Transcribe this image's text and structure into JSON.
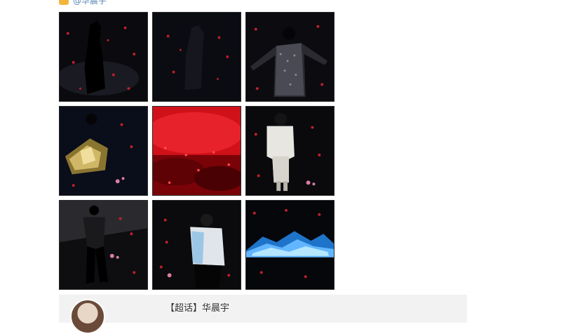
{
  "post": {
    "mention": "@华晨宇"
  },
  "grid": {
    "photos": [
      {
        "icon": "singer-silhouette-petals"
      },
      {
        "icon": "dark-stage-petals"
      },
      {
        "icon": "arms-spread-sequined-coat"
      },
      {
        "icon": "gold-costume-petals"
      },
      {
        "icon": "red-petal-field"
      },
      {
        "icon": "white-shirt-performer"
      },
      {
        "icon": "performer-dark-stage"
      },
      {
        "icon": "performer-white-jacket"
      },
      {
        "icon": "blue-ice-stage"
      }
    ]
  },
  "repost": {
    "tag": "【超话】华晨宇"
  }
}
